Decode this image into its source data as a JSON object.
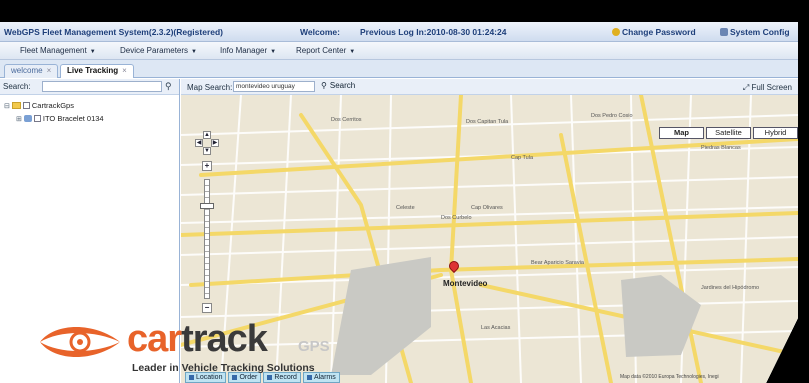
{
  "titlebar": {
    "app_name": "WebGPS Fleet Management System(2.3.2)(Registered)",
    "welcome": "Welcome:",
    "last_login": "Previous Log In:2010-08-30 01:24:24",
    "change_password": "Change Password",
    "system_config": "System Config"
  },
  "menubar": {
    "items": [
      {
        "label": "Fleet Management"
      },
      {
        "label": "Device Parameters"
      },
      {
        "label": "Info Manager"
      },
      {
        "label": "Report Center"
      }
    ]
  },
  "tabs": [
    {
      "label": "welcome",
      "active": false
    },
    {
      "label": "Live Tracking",
      "active": true
    }
  ],
  "leftpanel": {
    "search_label": "Search:",
    "tree": [
      {
        "label": "CartrackGps"
      },
      {
        "label": "ITO Bracelet 0134"
      }
    ]
  },
  "maptoolbar": {
    "search_label": "Map Search:",
    "search_value": "montevideo uruguay",
    "search_button": "Search",
    "full_screen": "Full Screen"
  },
  "map": {
    "types": [
      {
        "label": "Map",
        "active": true
      },
      {
        "label": "Satellite",
        "active": false
      },
      {
        "label": "Hybrid",
        "active": false
      }
    ],
    "city_label": "Montevideo",
    "street_labels": [
      "Dos Cerritos",
      "Dos Capitan Tula",
      "Dos Pedro Cosio",
      "Cap Tula",
      "Piedras Blancas",
      "Dos Curbelo",
      "Celeste",
      "Cap Olivares",
      "Bear Aparicio Saravia",
      "Jardines del Hipódromo",
      "Las Acacias"
    ],
    "copyright": "Map data ©2010 Europa Technologies, Inegi"
  },
  "bottomtabs": [
    {
      "label": "Location"
    },
    {
      "label": "Order"
    },
    {
      "label": "Record"
    },
    {
      "label": "Alarms"
    }
  ],
  "logo": {
    "word_car": "car",
    "word_track": "track",
    "suffix": "GPS",
    "tagline": "Leader in Vehicle Tracking Solutions"
  }
}
